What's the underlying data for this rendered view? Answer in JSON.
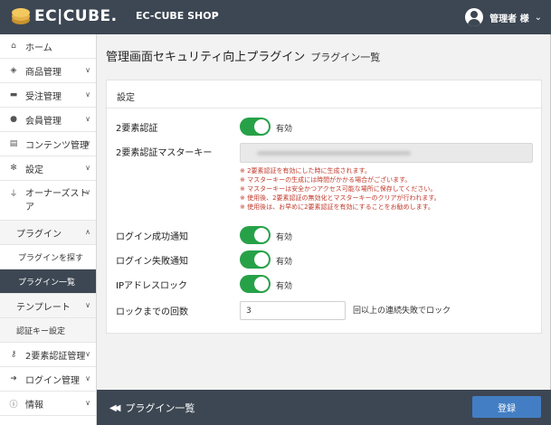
{
  "header": {
    "logo_text": "EC|CUBE.",
    "shop_name": "EC-CUBE SHOP",
    "user_name": "管理者 様"
  },
  "sidebar": {
    "items": [
      {
        "label": "ホーム",
        "icon": "home-icon"
      },
      {
        "label": "商品管理",
        "icon": "cube-icon"
      },
      {
        "label": "受注管理",
        "icon": "cart-icon"
      },
      {
        "label": "会員管理",
        "icon": "users-icon"
      },
      {
        "label": "コンテンツ管理",
        "icon": "file-icon"
      },
      {
        "label": "設定",
        "icon": "gear-icon"
      },
      {
        "label": "オーナーズストア",
        "icon": "plug-icon"
      },
      {
        "label": "プラグイン"
      },
      {
        "label": "プラグインを探す"
      },
      {
        "label": "プラグイン一覧"
      },
      {
        "label": "テンプレート"
      },
      {
        "label": "認証キー設定"
      },
      {
        "label": "2要素認証管理",
        "icon": "key-icon"
      },
      {
        "label": "ログイン管理",
        "icon": "sign-in-icon"
      },
      {
        "label": "情報",
        "icon": "info-icon"
      }
    ]
  },
  "page": {
    "title": "管理画面セキュリティ向上プラグイン",
    "subtitle": "プラグイン一覧"
  },
  "card": {
    "header": "設定",
    "two_factor_label": "2要素認証",
    "two_factor_state": "有効",
    "master_key_label": "2要素認証マスターキー",
    "notes": [
      "※ 2要素認証を有効にした時に生成されます。",
      "※ マスターキーの生成には時間がかかる場合がございます。",
      "※ マスターキーは安全かつアクセス可能な場所に保存してください。",
      "※ 使用後、2要素認証の無効化とマスターキーのクリアが行われます。",
      "※ 使用後は、お早めに2要素認証を有効にすることをお勧めします。"
    ],
    "login_success_label": "ログイン成功通知",
    "login_success_state": "有効",
    "login_fail_label": "ログイン失敗通知",
    "login_fail_state": "有効",
    "ip_lock_label": "IPアドレスロック",
    "ip_lock_state": "有効",
    "lock_count_label": "ロックまでの回数",
    "lock_count_value": "3",
    "lock_count_suffix": "回以上の連続失敗でロック"
  },
  "footer": {
    "back_label": "プラグイン一覧",
    "save_label": "登録"
  },
  "colors": {
    "header_bg": "#3d4753",
    "toggle_on": "#27a148",
    "save_button": "#437ec4",
    "note_text": "#c0392b"
  }
}
